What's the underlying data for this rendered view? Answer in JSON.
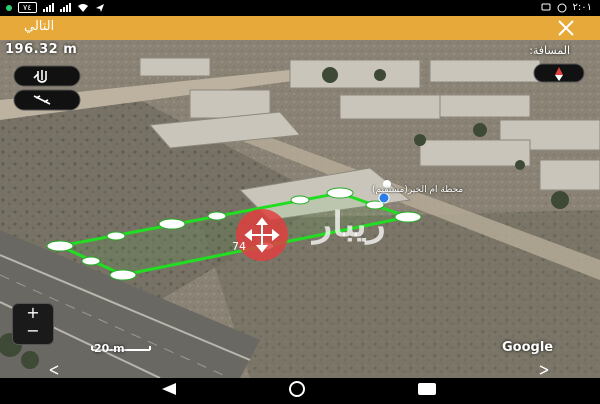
{
  "status_bar": {
    "time": "٢:٠١",
    "battery_percent": "٧٤",
    "icons": [
      "green-dot-icon",
      "battery-icon",
      "signal-icon",
      "wifi-icon",
      "send-icon",
      "whatsapp-icon",
      "chat-icon"
    ]
  },
  "top_bar": {
    "next_label": "التالي",
    "close_icon": "close-icon",
    "color": "#e6a93a"
  },
  "map": {
    "distance_value": "196.32 m",
    "distance_label": ":المسافة",
    "place_name": "محطة ام الخير(مستقيم)",
    "segment_label": "74",
    "watermark": "ريبار",
    "scale_label": "20 m",
    "attribution": "Google",
    "zoom_in_label": "+",
    "zoom_out_label": "−",
    "polygon_color": "#22dd22",
    "vertex_color": "#ffffff",
    "pin_color": "#2b7de9",
    "move_handle_color": "#e04040",
    "buttons": [
      "layers-icon",
      "hand-pointer-icon",
      "ruler-icon",
      "compass-icon"
    ]
  },
  "nav_bar": {
    "buttons": [
      "back-icon",
      "home-icon",
      "recents-icon"
    ]
  }
}
